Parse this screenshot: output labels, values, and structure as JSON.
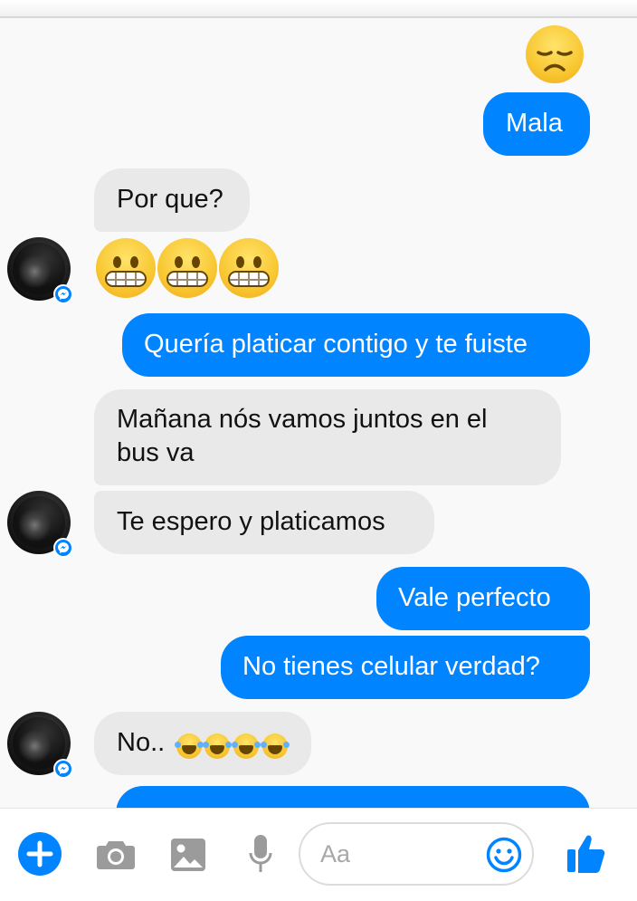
{
  "conversation": {
    "messages": [
      {
        "direction": "outgoing",
        "text": "Mala"
      },
      {
        "direction": "incoming",
        "text": "Por que?"
      },
      {
        "direction": "outgoing",
        "text": "Quería platicar contigo y te fuiste"
      },
      {
        "direction": "incoming",
        "lines": [
          "Mañana nós vamos juntos en el",
          "bus va"
        ]
      },
      {
        "direction": "incoming",
        "text": "Te espero y platicamos"
      },
      {
        "direction": "outgoing",
        "text": "Vale perfecto"
      },
      {
        "direction": "outgoing",
        "text": "No tienes celular verdad?"
      },
      {
        "direction": "incoming",
        "text": "No.."
      }
    ],
    "emojis": {
      "disappointed": "disappointed-face-emoji",
      "grimacing": "grimacing-face-emoji",
      "tears_of_joy": "face-with-tears-of-joy-emoji"
    }
  },
  "composer": {
    "placeholder": "Aa",
    "icons": [
      "plus-icon",
      "camera-icon",
      "image-icon",
      "microphone-icon",
      "smiley-icon",
      "thumbs-up-icon"
    ]
  },
  "colors": {
    "outgoing_bubble": "#0084ff",
    "incoming_bubble": "#e9e9ea",
    "accent": "#0084ff",
    "icon_gray": "#9b9b9b"
  }
}
